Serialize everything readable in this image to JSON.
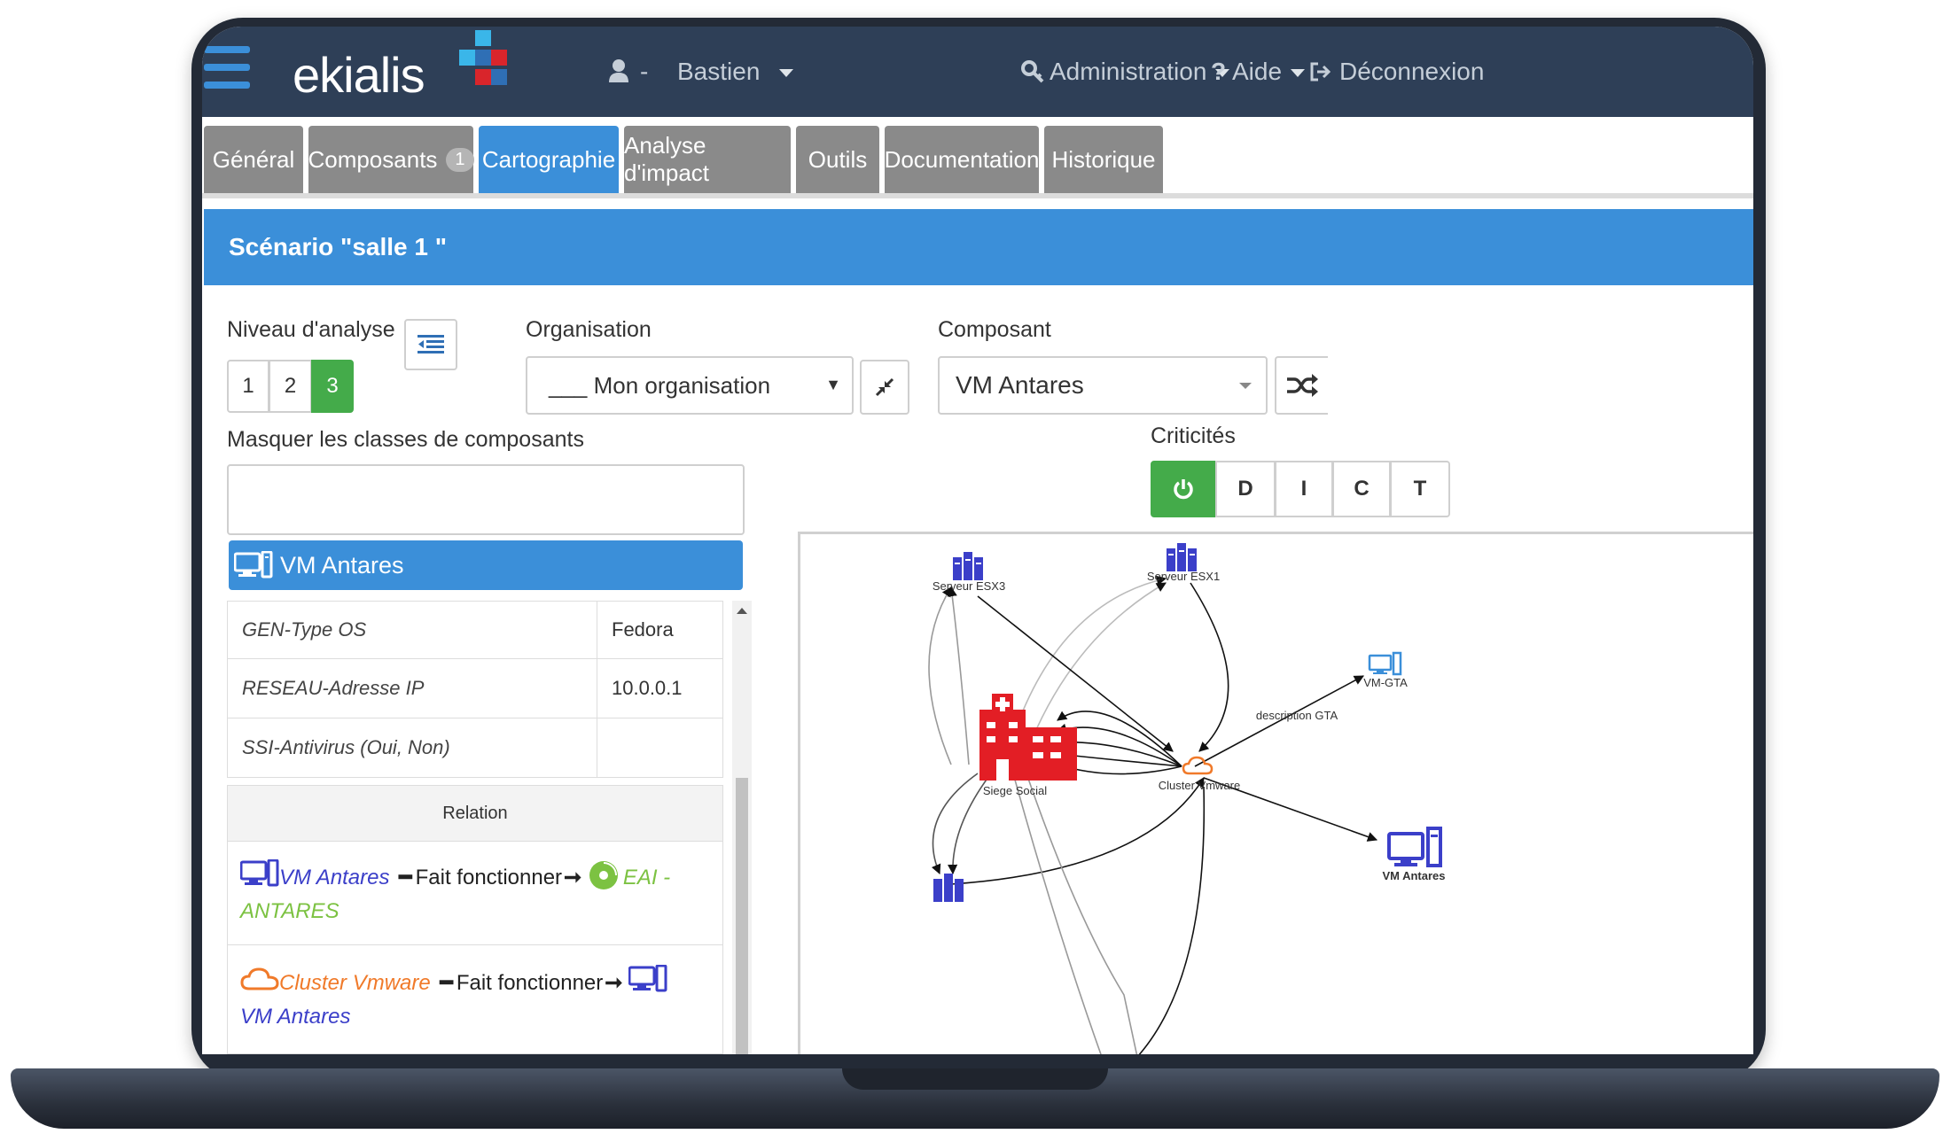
{
  "app": {
    "logo": "ekialis",
    "user_separator": "-",
    "user_name": "Bastien",
    "menu_admin": "Administration",
    "menu_help": "Aide",
    "menu_logout": "Déconnexion"
  },
  "tabs": [
    {
      "label": "Général"
    },
    {
      "label": "Composants",
      "badge": "1"
    },
    {
      "label": "Cartographie"
    },
    {
      "label": "Analyse d'impact"
    },
    {
      "label": "Outils"
    },
    {
      "label": "Documentation"
    },
    {
      "label": "Historique"
    }
  ],
  "active_tab": "Cartographie",
  "scenario_title": "Scénario \"salle 1 \"",
  "analysis": {
    "label": "Niveau d'analyse",
    "levels": [
      "1",
      "2",
      "3"
    ],
    "selected": "3"
  },
  "organisation": {
    "label": "Organisation",
    "value": "___ Mon organisation"
  },
  "component": {
    "label": "Composant",
    "value": "VM Antares"
  },
  "hide_classes_label": "Masquer les classes de composants",
  "criticities": {
    "label": "Criticités",
    "buttons": [
      "D",
      "I",
      "C",
      "T"
    ]
  },
  "details": {
    "title": "VM Antares",
    "rows": [
      {
        "key": "GEN-Type OS",
        "value": "Fedora"
      },
      {
        "key": "RESEAU-Adresse IP",
        "value": "10.0.0.1"
      },
      {
        "key": "SSI-Antivirus (Oui, Non)",
        "value": ""
      }
    ],
    "relation_header": "Relation",
    "relations": [
      {
        "from": "VM Antares",
        "verb": "Fait fonctionner",
        "to_1": "EAI -",
        "to_2": "ANTARES"
      },
      {
        "from": "Cluster Vmware",
        "verb": "Fait fonctionner",
        "to": "VM Antares"
      }
    ]
  },
  "graph": {
    "nodes": {
      "esx3": "Serveur ESX3",
      "esx1": "Serveur ESX1",
      "vmgta": "VM-GTA",
      "siege": "Siege Social",
      "cluster": "Cluster Vmware",
      "vmantares": "VM Antares"
    },
    "edge_label": "description GTA"
  },
  "colors": {
    "navbar": "#2e3f57",
    "accent": "#3b8fd9",
    "tab_inactive": "#8a8a8a",
    "success": "#44ab4a",
    "site_red": "#e31e25",
    "server_blue": "#3b3fc9",
    "cluster_orange": "#f07a2a",
    "eai_green": "#7cc242"
  }
}
